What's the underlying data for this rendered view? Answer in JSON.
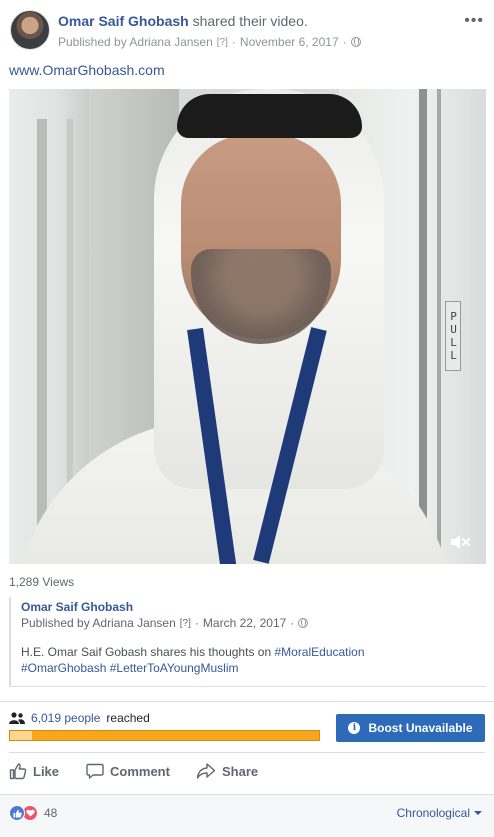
{
  "header": {
    "author": "Omar Saif Ghobash",
    "action": "shared their video.",
    "published_by": "Published by Adriana Jansen",
    "hint": "[?]",
    "date": "November 6, 2017"
  },
  "post": {
    "link": "www.OmarGhobash.com"
  },
  "video": {
    "sign_text": "PULL",
    "views": "1,289 Views"
  },
  "shared_post": {
    "author": "Omar Saif Ghobash",
    "published_by": "Published by Adriana Jansen",
    "hint": "[?]",
    "date": "March 22, 2017",
    "text_prefix": "H.E. Omar Saif Gobash shares his thoughts on",
    "tags": [
      "#MoralEducation",
      "#OmarGhobash",
      "#LetterToAYoungMuslim"
    ]
  },
  "reach": {
    "count": "6,019 people",
    "label": "reached",
    "progress_fraction": 0.07
  },
  "boost": {
    "label": "Boost Unavailable"
  },
  "actions": {
    "like": "Like",
    "comment": "Comment",
    "share": "Share"
  },
  "footer": {
    "reaction_count": "48",
    "sort_label": "Chronological"
  },
  "colors": {
    "link_blue": "#365899",
    "boost_blue": "#2d6ab8",
    "reach_orange": "#f7a51b",
    "like_blue": "#4a79d8",
    "love_red": "#f25268"
  }
}
